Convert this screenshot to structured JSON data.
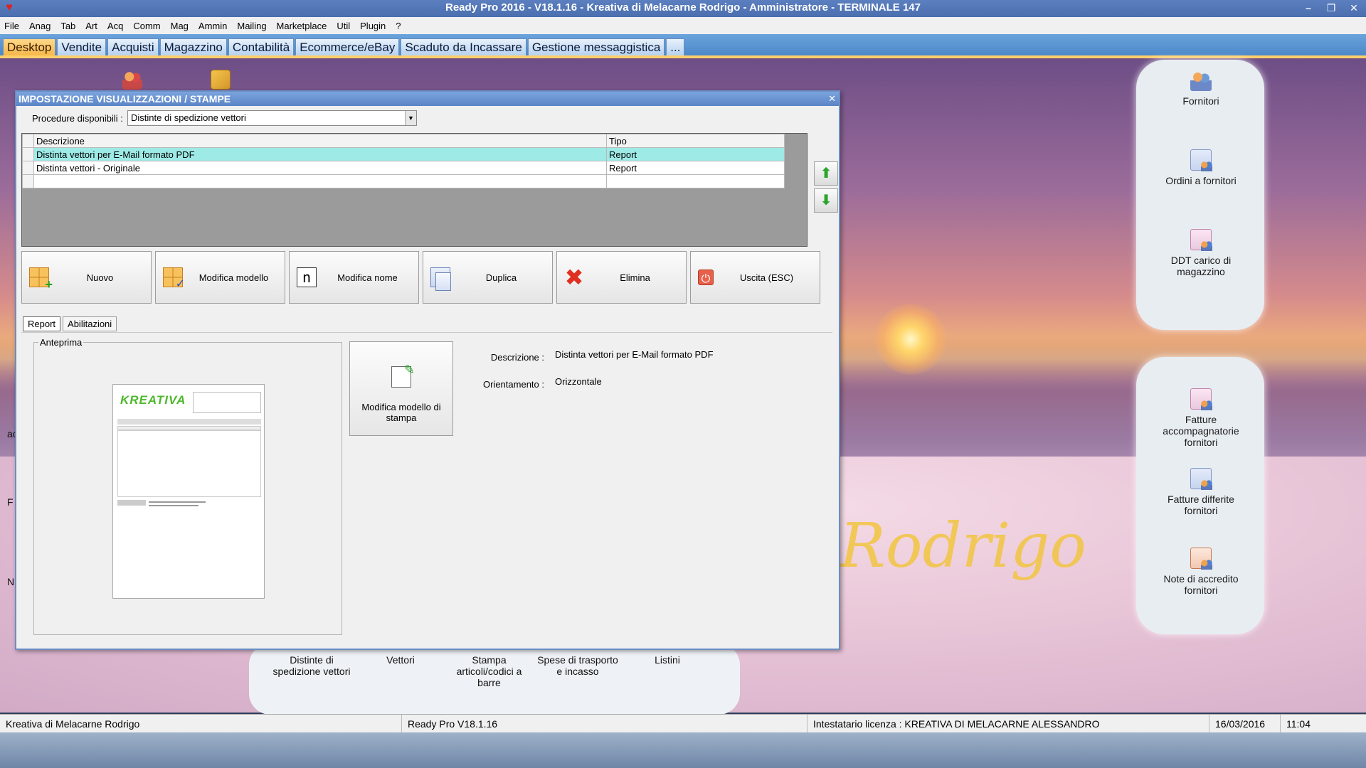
{
  "window": {
    "title": "Ready Pro 2016 - V18.1.16 - Kreativa di Melacarne Rodrigo - Amministratore - TERMINALE 147"
  },
  "menu": [
    "File",
    "Anag",
    "Tab",
    "Art",
    "Acq",
    "Comm",
    "Mag",
    "Ammin",
    "Mailing",
    "Marketplace",
    "Util",
    "Plugin",
    "?"
  ],
  "tabs": [
    "Desktop",
    "Vendite",
    "Acquisti",
    "Magazzino",
    "Contabilità",
    "Ecommerce/eBay",
    "Scaduto da Incassare",
    "Gestione messaggistica",
    "..."
  ],
  "desktop": {
    "watermark": "Rodrigo",
    "right_icons": [
      {
        "label": "Fornitori",
        "icon": "people-icon"
      },
      {
        "label": "Ordini a fornitori",
        "icon": "document-people-icon"
      },
      {
        "label": "DDT carico di magazzino",
        "icon": "document-people-icon"
      },
      {
        "label": "Fatture accompagnatorie fornitori",
        "icon": "document-people-icon"
      },
      {
        "label": "Fatture differite fornitori",
        "icon": "document-people-icon"
      },
      {
        "label": "Note di accredito fornitori",
        "icon": "document-people-icon"
      }
    ],
    "bottom_icons": [
      {
        "label": "Distinte di spedizione vettori"
      },
      {
        "label": "Vettori"
      },
      {
        "label": "Stampa articoli/codici a barre"
      },
      {
        "label": "Spese di trasporto e incasso"
      },
      {
        "label": "Listini"
      }
    ],
    "left_fragments": [
      "ac",
      "F",
      "N"
    ]
  },
  "dialog": {
    "title": "IMPOSTAZIONE VISUALIZZAZIONI / STAMPE",
    "procedure_label": "Procedure disponibili :",
    "procedure_value": "Distinte di spedizione vettori",
    "grid": {
      "columns": [
        "Descrizione",
        "Tipo"
      ],
      "rows": [
        {
          "descrizione": "Distinta vettori per E-Mail formato PDF",
          "tipo": "Report",
          "selected": true
        },
        {
          "descrizione": "Distinta vettori - Originale",
          "tipo": "Report",
          "selected": false
        },
        {
          "descrizione": "",
          "tipo": "",
          "selected": false
        }
      ]
    },
    "toolbar": {
      "new_label": "Nuovo",
      "edit_model_label": "Modifica modello",
      "rename_label": "Modifica nome",
      "duplicate_label": "Duplica",
      "delete_label": "Elimina",
      "exit_label": "Uscita (ESC)"
    },
    "subtabs": [
      "Report",
      "Abilitazioni"
    ],
    "preview_legend": "Anteprima",
    "preview_logo": "KREATIVA",
    "edit_print_model_label": "Modifica modello di stampa",
    "fields": {
      "descrizione_label": "Descrizione :",
      "descrizione_value": "Distinta vettori per E-Mail formato PDF",
      "orientamento_label": "Orientamento :",
      "orientamento_value": "Orizzontale"
    }
  },
  "statusbar": {
    "company": "Kreativa di Melacarne Rodrigo",
    "version": "Ready Pro V18.1.16",
    "license": "Intestatario licenza : KREATIVA DI MELACARNE ALESSANDRO",
    "date": "16/03/2016",
    "time": "11:04"
  },
  "colors": {
    "tab_active": "#f5b84a",
    "grid_selected": "#9eeae6",
    "title_bar": "#4a6eae",
    "watermark": "#f2c64a"
  }
}
